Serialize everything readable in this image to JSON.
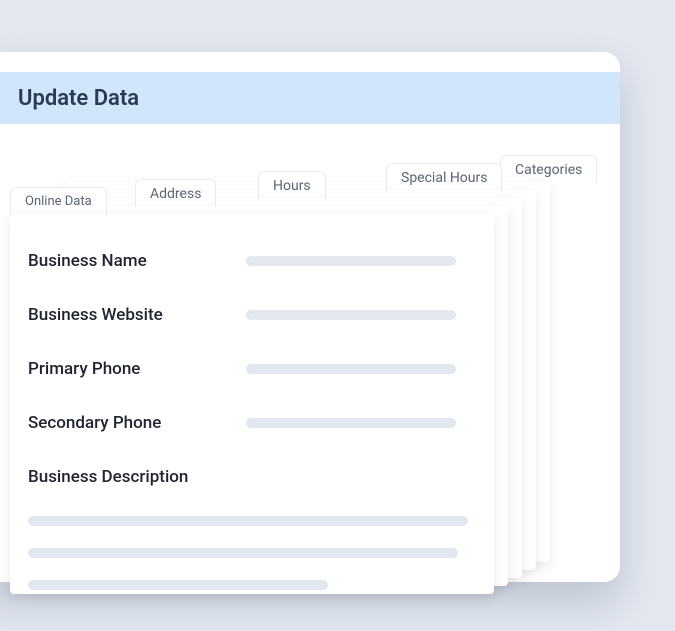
{
  "header": {
    "title": "Update Data"
  },
  "tabs": {
    "t1": "Online Data",
    "t2": "Address",
    "t3": "Hours",
    "t4": "Special Hours",
    "t5": "Categories"
  },
  "fields": {
    "business_name": "Business Name",
    "business_website": "Business Website",
    "primary_phone": "Primary Phone",
    "secondary_phone": "Secondary Phone",
    "business_description": "Business Description"
  }
}
